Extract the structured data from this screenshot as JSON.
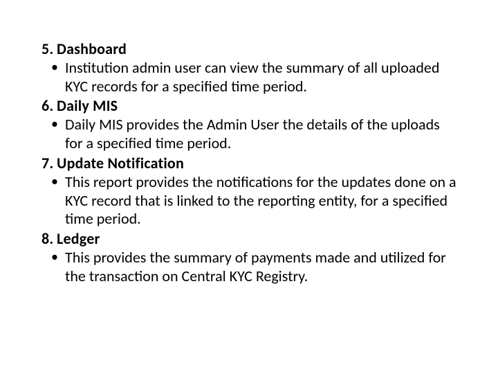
{
  "sections": [
    {
      "heading": "5. Dashboard",
      "bullet": "Institution admin user can view the summary of all uploaded KYC records for a specified time period."
    },
    {
      "heading": "6. Daily MIS",
      "bullet": "Daily MIS provides the Admin User the details of the uploads for a specified time period."
    },
    {
      "heading": "7. Update Notification",
      "bullet": "This report provides the notifications for the updates done on a KYC record that is linked to the reporting entity, for a specified time period."
    },
    {
      "heading": "8. Ledger",
      "bullet": "This provides the summary of payments made and utilized for the transaction on Central KYC Registry."
    }
  ]
}
